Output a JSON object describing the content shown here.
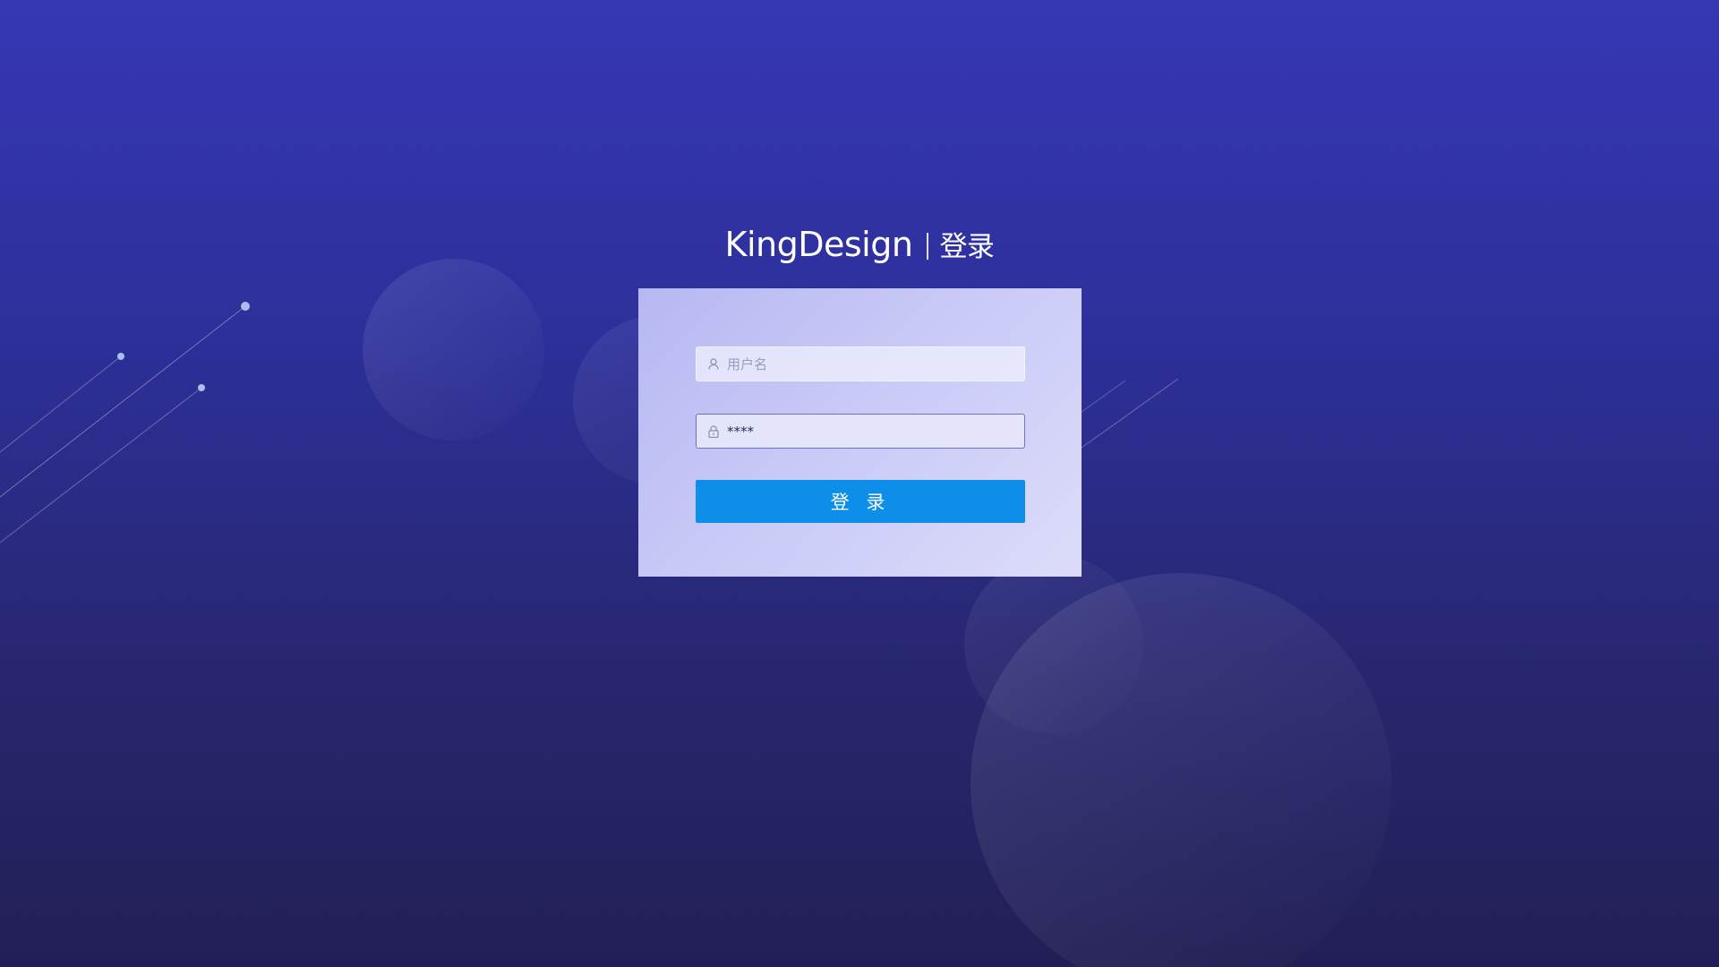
{
  "header": {
    "brand": "KingDesign",
    "title": "登录"
  },
  "login_form": {
    "username": {
      "placeholder": "用户名",
      "value": ""
    },
    "password": {
      "placeholder": "",
      "value": "****"
    },
    "submit_label": "登 录"
  },
  "icons": {
    "username": "user-icon",
    "password": "lock-icon"
  },
  "colors": {
    "background_top": "#3637b4",
    "background_bottom": "#221f55",
    "card": "#c8c9f7",
    "button": "#0d8ee8"
  }
}
